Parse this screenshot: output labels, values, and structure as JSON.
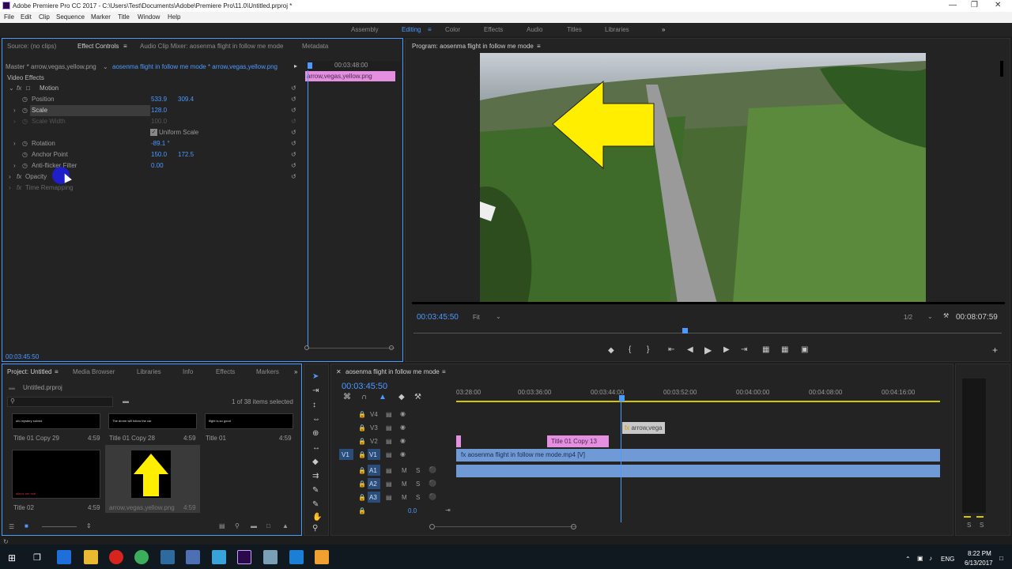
{
  "titlebar": {
    "text": "Adobe Premiere Pro CC 2017 - C:\\Users\\Test\\Documents\\Adobe\\Premiere Pro\\11.0\\Untitled.prproj *"
  },
  "menu": [
    "File",
    "Edit",
    "Clip",
    "Sequence",
    "Marker",
    "Title",
    "Window",
    "Help"
  ],
  "workspaces": [
    "Assembly",
    "Editing",
    "Color",
    "Effects",
    "Audio",
    "Titles",
    "Libraries"
  ],
  "ec": {
    "tabs": [
      "Source: (no clips)",
      "Effect Controls",
      "Audio Clip Mixer: aosenma flight in follow me mode",
      "Metadata"
    ],
    "master": "Master * arrow,vegas,yellow.png",
    "clip": "aosenma flight in follow me mode * arrow,vegas,yellow.png",
    "timecode_top": "00:03:48:00",
    "clip_label": "arrow,vegas,yellow.png",
    "video_effects": "Video Effects",
    "motion": "Motion",
    "position": "Position",
    "pos_x": "533.9",
    "pos_y": "309.4",
    "scale": "Scale",
    "scale_v": "128.0",
    "scale_width": "Scale Width",
    "scale_width_v": "100.0",
    "uniform": "Uniform Scale",
    "rotation": "Rotation",
    "rotation_v": "-89.1 °",
    "anchor": "Anchor Point",
    "anchor_x": "150.0",
    "anchor_y": "172.5",
    "antiflicker": "Anti-flicker Filter",
    "antiflicker_v": "0.00",
    "opacity": "Opacity",
    "timeremap": "Time Remapping",
    "tc_bottom": "00:03:45:50"
  },
  "program": {
    "title": "Program: aosenma flight in follow me mode",
    "tc": "00:03:45:50",
    "fit": "Fit",
    "res": "1/2",
    "duration": "00:08:07:59"
  },
  "project": {
    "tabs": [
      "Project: Untitled",
      "Media Browser",
      "Libraries",
      "Info",
      "Effects",
      "Markers"
    ],
    "file": "Untitled.prproj",
    "count": "1 of 38 items selected",
    "items": [
      {
        "name": "Title 01 Copy 29",
        "dur": "4:59",
        "txt": "ufo mystery solved"
      },
      {
        "name": "Title 01 Copy 28",
        "dur": "4:59",
        "txt": "The drone will follow the car"
      },
      {
        "name": "Title 01",
        "dur": "4:59",
        "txt": "flight is so good"
      },
      {
        "name": "Title 02",
        "dur": "4:59",
        "txt": "aliens are real"
      },
      {
        "name": "arrow,vegas,yellow.png",
        "dur": "4:59",
        "txt": ""
      }
    ]
  },
  "timeline": {
    "tab": "aosenma flight in follow me mode",
    "tc": "00:03:45:50",
    "ruler": [
      "03:28:00",
      "00:03:36:00",
      "00:03:44:00",
      "00:03:52:00",
      "00:04:00:00",
      "00:04:08:00",
      "00:04:16:00"
    ],
    "tracks": [
      "V4",
      "V3",
      "V2",
      "V1",
      "A1",
      "A2",
      "A3"
    ],
    "clip_arrow": "arrow,vega",
    "clip_title": "Title 01 Copy 13",
    "clip_video": "aosenma flight in follow me mode.mp4 [V]",
    "master_val": "0.0",
    "src_v": "V1",
    "src_a": "A1"
  },
  "taskbar": {
    "lang": "ENG",
    "time": "8:22 PM",
    "date": "6/13/2017"
  },
  "colors": {
    "accent": "#4c9aff",
    "pink": "#e58fe0",
    "clip_blue": "#6f9ad6",
    "arrow": "#ffee00"
  }
}
